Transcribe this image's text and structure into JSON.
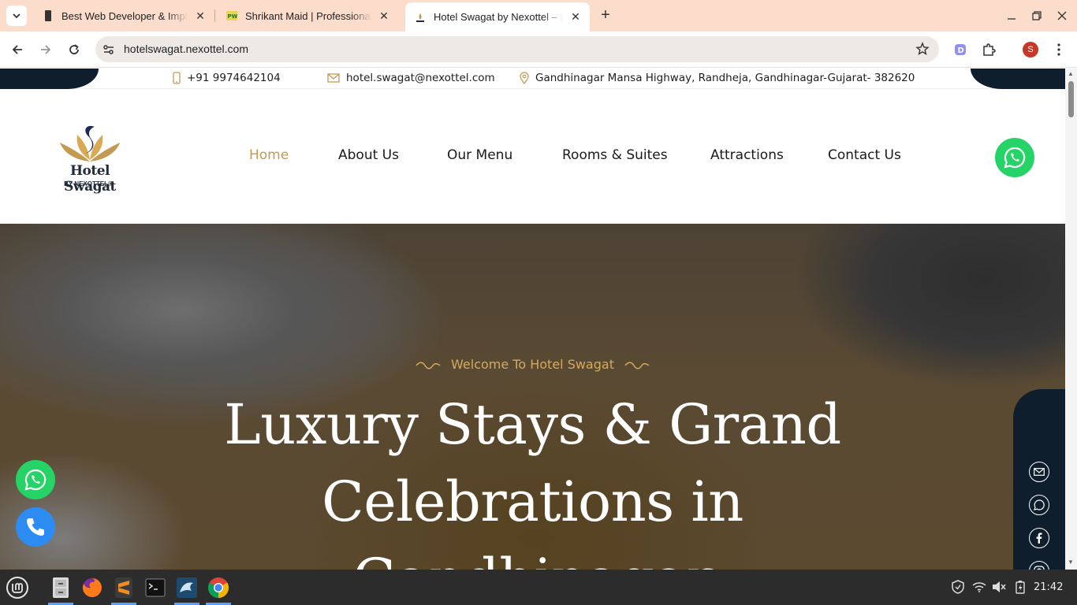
{
  "browser": {
    "tabs": [
      {
        "title": "Best Web Developer & Implementation",
        "active": false,
        "icon": "site-favicon-dark"
      },
      {
        "title": "Shrikant Maid | Professional",
        "active": false,
        "icon": "site-favicon-pw"
      },
      {
        "title": "Hotel Swagat by Nexottel – Hotel",
        "active": true,
        "icon": "hotel-swagat-favicon"
      }
    ],
    "new_tab_label": "+",
    "url": "hotelswagat.nexottel.com",
    "profile_initial": "S"
  },
  "topbar": {
    "phone": "+91 9974642104",
    "email": "hotel.swagat@nexottel.com",
    "address": "Gandhinagar Mansa Highway, Randheja, Gandhinagar-Gujarat- 382620"
  },
  "logo": {
    "name": "Hotel Swagat",
    "by": "BY NEXOTTEL®"
  },
  "nav": {
    "items": [
      {
        "label": "Home",
        "active": true
      },
      {
        "label": "About Us",
        "active": false
      },
      {
        "label": "Our Menu",
        "active": false
      },
      {
        "label": "Rooms & Suites",
        "active": false
      },
      {
        "label": "Attractions",
        "active": false
      },
      {
        "label": "Contact Us",
        "active": false
      }
    ]
  },
  "hero": {
    "welcome": "Welcome To Hotel Swagat",
    "line1": "Luxury Stays & Grand",
    "line2": "Celebrations in",
    "line3": "Gandhinagar"
  },
  "side_social": [
    "email-icon",
    "whatsapp-icon",
    "facebook-icon",
    "instagram-icon"
  ],
  "colors": {
    "accent_gold": "#c49a52",
    "navy": "#0e1e2c",
    "whatsapp": "#25d366",
    "phone_blue": "#2c8cf1"
  },
  "taskbar": {
    "apps": [
      "mint-menu",
      "file-manager",
      "firefox",
      "sublime-text",
      "terminal",
      "mysql-workbench",
      "chrome"
    ],
    "clock": "21:42"
  }
}
